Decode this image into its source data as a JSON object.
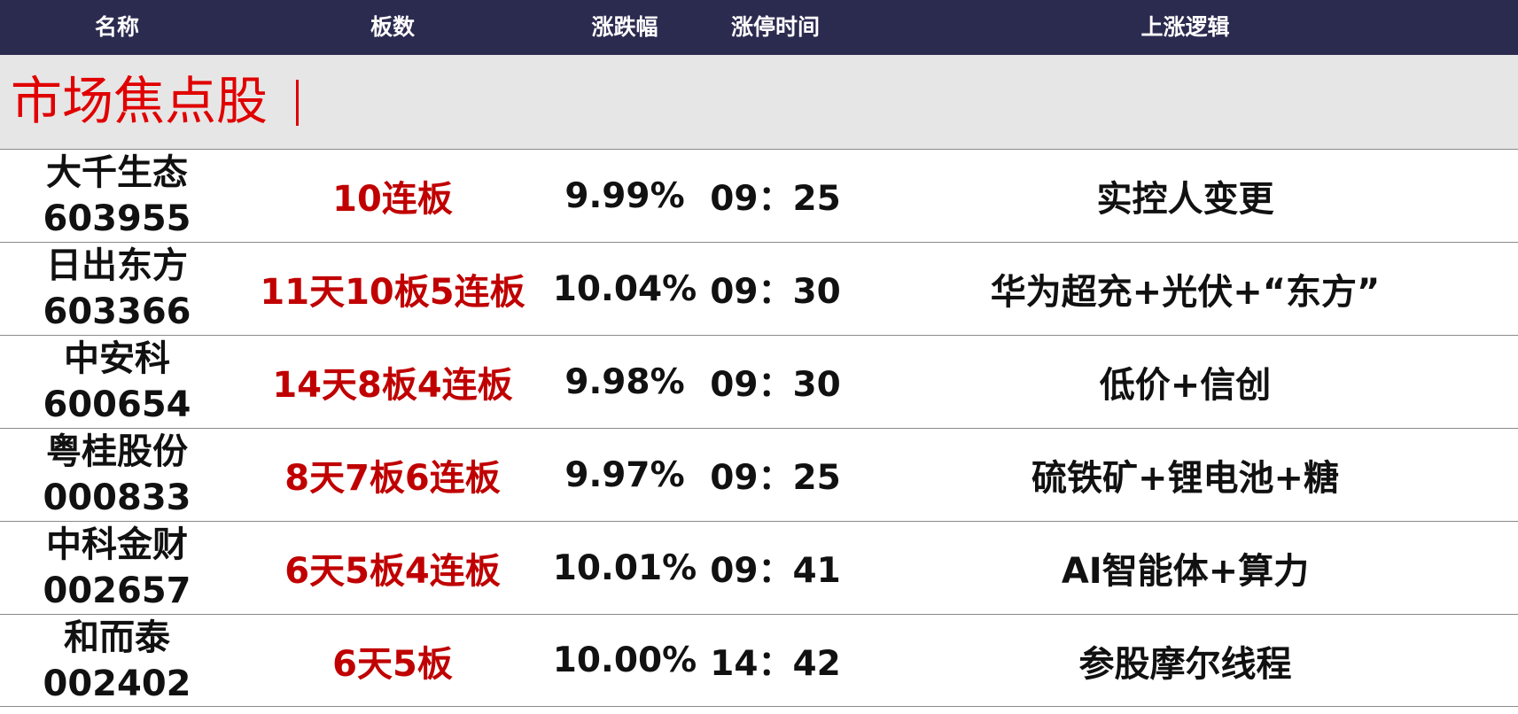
{
  "header": {
    "columns": [
      "名称",
      "板数",
      "涨跌幅",
      "涨停时间",
      "上涨逻辑"
    ]
  },
  "section": {
    "title": "市场焦点股"
  },
  "colors": {
    "header_bg": "#2b2a4f",
    "header_text": "#ffffff",
    "section_bg": "#e6e6e6",
    "section_title": "#e00000",
    "boards_text": "#c00000",
    "body_text": "#111111"
  },
  "rows": [
    {
      "name": "大千生态",
      "code": "603955",
      "boards": "10连板",
      "change": "9.99%",
      "time": "09：25",
      "logic": "实控人变更"
    },
    {
      "name": "日出东方",
      "code": "603366",
      "boards": "11天10板5连板",
      "change": "10.04%",
      "time": "09：30",
      "logic": "华为超充+光伏+“东方”"
    },
    {
      "name": "中安科",
      "code": "600654",
      "boards": "14天8板4连板",
      "change": "9.98%",
      "time": "09：30",
      "logic": "低价+信创"
    },
    {
      "name": "粤桂股份",
      "code": "000833",
      "boards": "8天7板6连板",
      "change": "9.97%",
      "time": "09：25",
      "logic": "硫铁矿+锂电池+糖"
    },
    {
      "name": "中科金财",
      "code": "002657",
      "boards": "6天5板4连板",
      "change": "10.01%",
      "time": "09：41",
      "logic": "AI智能体+算力"
    },
    {
      "name": "和而泰",
      "code": "002402",
      "boards": "6天5板",
      "change": "10.00%",
      "time": "14：42",
      "logic": "参股摩尔线程"
    }
  ]
}
